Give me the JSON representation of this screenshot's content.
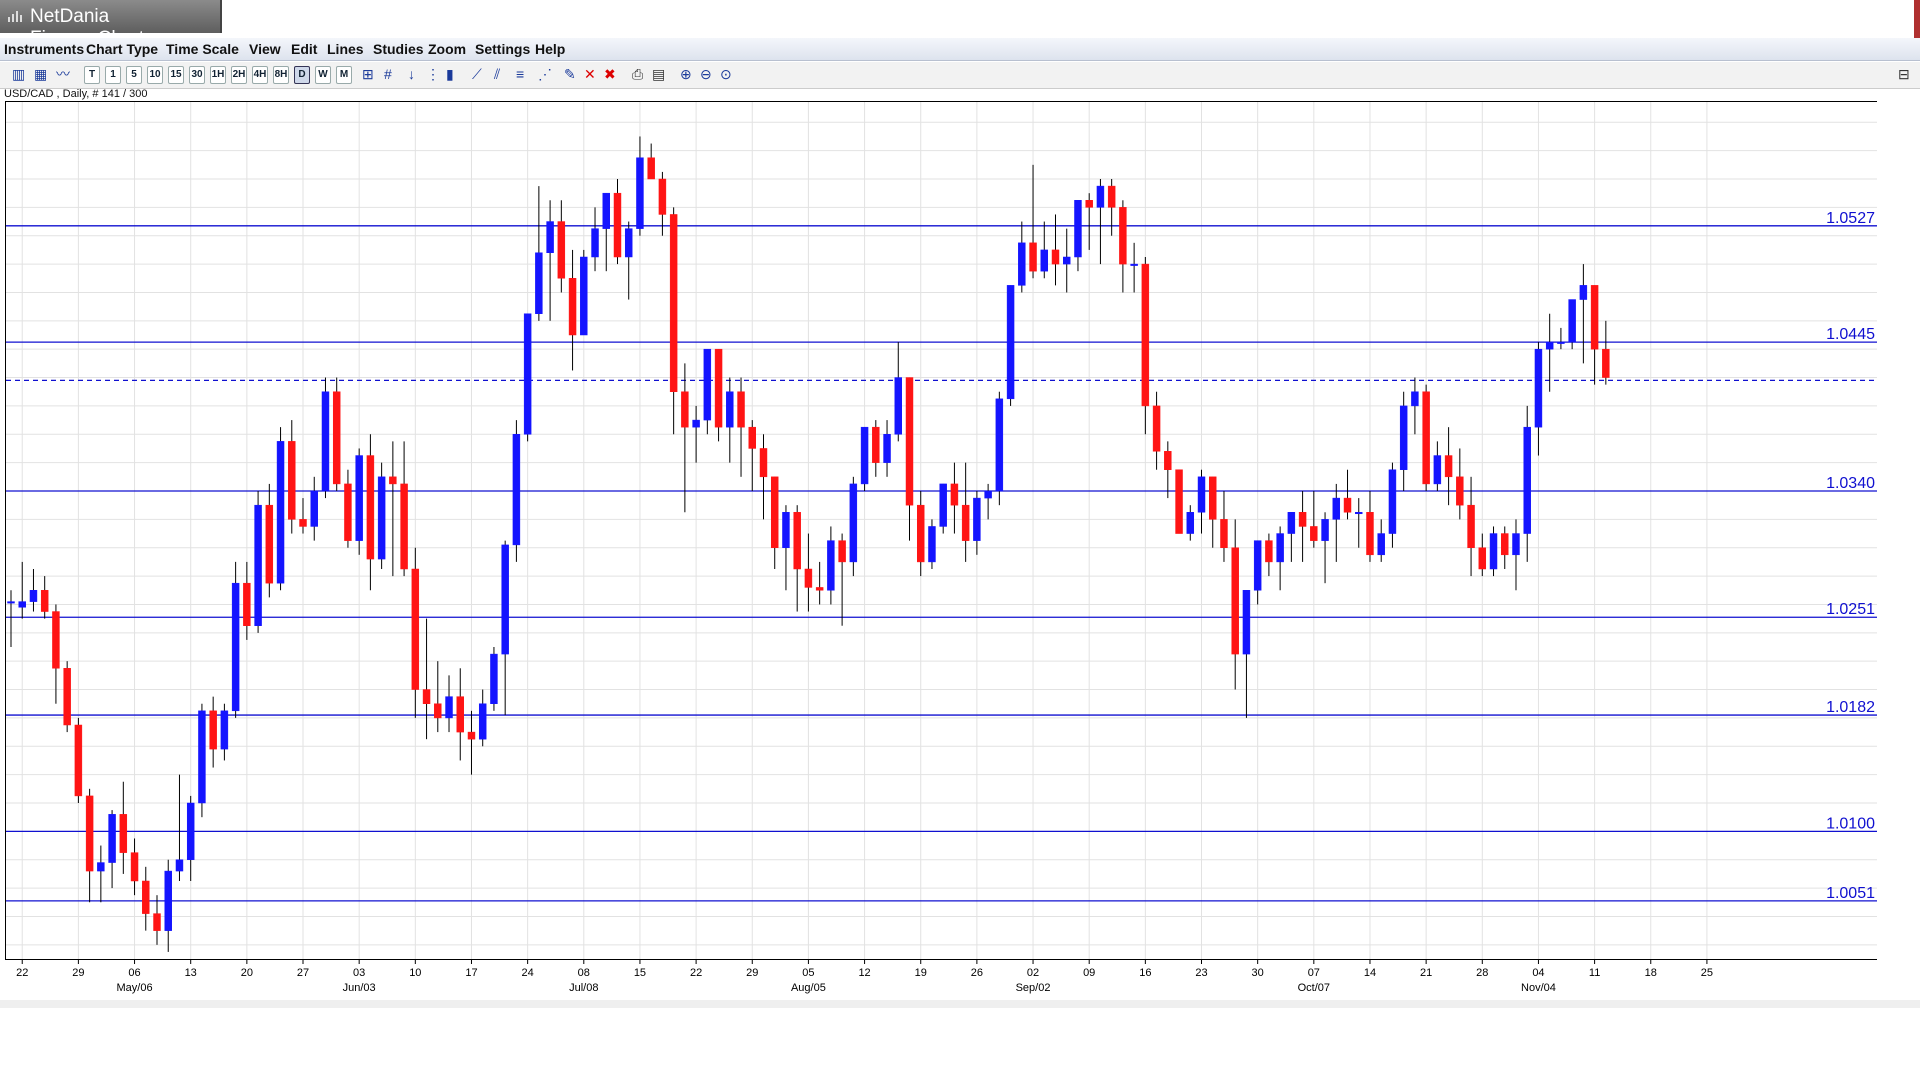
{
  "window": {
    "title": "NetDania FinanceChart"
  },
  "menu": [
    "Instruments",
    "Chart Type",
    "Time Scale",
    "View",
    "Edit",
    "Lines",
    "Studies",
    "Zoom",
    "Settings",
    "Help"
  ],
  "toolbar": {
    "timeframes": [
      "T",
      "1",
      "5",
      "10",
      "15",
      "30",
      "1H",
      "2H",
      "4H",
      "8H",
      "D",
      "W",
      "M"
    ],
    "selected": "D"
  },
  "status": {
    "text": "USD/CAD , Daily, # 141 / 300"
  },
  "chart_data": {
    "type": "candlestick",
    "instrument": "USD/CAD",
    "timeframe": "Daily",
    "ylim": [
      1.001,
      1.0615
    ],
    "y_ticks": [
      "1.0600",
      "1.0580",
      "1.0560",
      "1.0540",
      "1.0520",
      "1.0500",
      "1.0480",
      "1.0460",
      "1.0440",
      "1.0420",
      "1.0400",
      "1.0380",
      "1.0360",
      "1.0340",
      "1.0320",
      "1.0300",
      "1.0280",
      "1.0260",
      "1.0240",
      "1.0220",
      "1.0200",
      "1.0180",
      "1.0160",
      "1.0140",
      "1.0120",
      "1.0100",
      "1.0080",
      "1.0060",
      "1.0040",
      "1.0020"
    ],
    "x_ticks": [
      "22",
      "29",
      "06",
      "13",
      "20",
      "27",
      "03",
      "10",
      "17",
      "24",
      "08",
      "15",
      "22",
      "29",
      "05",
      "12",
      "19",
      "26",
      "02",
      "09",
      "16",
      "23",
      "30",
      "07",
      "14",
      "21",
      "28",
      "04",
      "11",
      "18",
      "25"
    ],
    "x_month_labels": [
      "May/06",
      "Jun/03",
      "Jul/08",
      "Aug/05",
      "Sep/02",
      "Oct/07",
      "Nov/04"
    ],
    "horizontal_lines": [
      "1.0527",
      "1.0445",
      "1.0340",
      "1.0251",
      "1.0182",
      "1.0100",
      "1.0051"
    ],
    "current_price": "1.0418",
    "grid": true,
    "candles": [
      [
        1.0262,
        1.027,
        1.023,
        1.0262
      ],
      [
        1.0258,
        1.029,
        1.025,
        1.0262
      ],
      [
        1.0262,
        1.0285,
        1.0255,
        1.027
      ],
      [
        1.027,
        1.028,
        1.025,
        1.0255
      ],
      [
        1.0255,
        1.026,
        1.019,
        1.0215
      ],
      [
        1.0215,
        1.022,
        1.017,
        1.0175
      ],
      [
        1.0175,
        1.018,
        1.012,
        1.0125
      ],
      [
        1.0125,
        1.013,
        1.005,
        1.0072
      ],
      [
        1.0072,
        1.009,
        1.005,
        1.0078
      ],
      [
        1.0078,
        1.0115,
        1.006,
        1.0112
      ],
      [
        1.0112,
        1.0135,
        1.007,
        1.0085
      ],
      [
        1.0085,
        1.0095,
        1.0055,
        1.0065
      ],
      [
        1.0065,
        1.0075,
        1.003,
        1.0042
      ],
      [
        1.0042,
        1.0055,
        1.002,
        1.003
      ],
      [
        1.003,
        1.008,
        1.0015,
        1.0072
      ],
      [
        1.0072,
        1.014,
        1.0065,
        1.008
      ],
      [
        1.008,
        1.0125,
        1.0065,
        1.012
      ],
      [
        1.012,
        1.019,
        1.011,
        1.0185
      ],
      [
        1.0185,
        1.0195,
        1.0145,
        1.0158
      ],
      [
        1.0158,
        1.019,
        1.015,
        1.0185
      ],
      [
        1.0185,
        1.029,
        1.018,
        1.0275
      ],
      [
        1.0275,
        1.029,
        1.0235,
        1.0245
      ],
      [
        1.0245,
        1.034,
        1.024,
        1.033
      ],
      [
        1.033,
        1.0345,
        1.0265,
        1.0275
      ],
      [
        1.0275,
        1.0385,
        1.027,
        1.0375
      ],
      [
        1.0375,
        1.039,
        1.031,
        1.032
      ],
      [
        1.032,
        1.0335,
        1.031,
        1.0315
      ],
      [
        1.0315,
        1.035,
        1.0305,
        1.034
      ],
      [
        1.034,
        1.042,
        1.0335,
        1.041
      ],
      [
        1.041,
        1.042,
        1.034,
        1.0345
      ],
      [
        1.0345,
        1.0355,
        1.03,
        1.0305
      ],
      [
        1.0305,
        1.037,
        1.0295,
        1.0365
      ],
      [
        1.0365,
        1.038,
        1.027,
        1.0292
      ],
      [
        1.0292,
        1.036,
        1.0285,
        1.035
      ],
      [
        1.035,
        1.0375,
        1.028,
        1.0345
      ],
      [
        1.0345,
        1.0375,
        1.028,
        1.0285
      ],
      [
        1.0285,
        1.03,
        1.018,
        1.02
      ],
      [
        1.02,
        1.025,
        1.0165,
        1.019
      ],
      [
        1.019,
        1.022,
        1.017,
        1.018
      ],
      [
        1.018,
        1.021,
        1.017,
        1.0195
      ],
      [
        1.0195,
        1.0215,
        1.015,
        1.017
      ],
      [
        1.017,
        1.0185,
        1.014,
        1.0165
      ],
      [
        1.0165,
        1.02,
        1.016,
        1.019
      ],
      [
        1.019,
        1.023,
        1.0185,
        1.0225
      ],
      [
        1.0225,
        1.0305,
        1.0182,
        1.0302
      ],
      [
        1.0302,
        1.039,
        1.029,
        1.038
      ],
      [
        1.038,
        1.0465,
        1.0375,
        1.0465
      ],
      [
        1.0465,
        1.0555,
        1.046,
        1.0508
      ],
      [
        1.0508,
        1.0545,
        1.046,
        1.053
      ],
      [
        1.053,
        1.0545,
        1.048,
        1.049
      ],
      [
        1.049,
        1.051,
        1.0425,
        1.045
      ],
      [
        1.045,
        1.051,
        1.045,
        1.0505
      ],
      [
        1.0505,
        1.054,
        1.0495,
        1.0525
      ],
      [
        1.0525,
        1.055,
        1.0495,
        1.055
      ],
      [
        1.055,
        1.056,
        1.05,
        1.0505
      ],
      [
        1.0505,
        1.053,
        1.0475,
        1.0525
      ],
      [
        1.0525,
        1.059,
        1.052,
        1.0575
      ],
      [
        1.0575,
        1.0585,
        1.056,
        1.056
      ],
      [
        1.056,
        1.0565,
        1.052,
        1.0535
      ],
      [
        1.0535,
        1.054,
        1.038,
        1.041
      ],
      [
        1.041,
        1.043,
        1.0325,
        1.0385
      ],
      [
        1.0385,
        1.04,
        1.036,
        1.039
      ],
      [
        1.039,
        1.044,
        1.038,
        1.044
      ],
      [
        1.044,
        1.044,
        1.0375,
        1.0385
      ],
      [
        1.0385,
        1.042,
        1.036,
        1.041
      ],
      [
        1.041,
        1.042,
        1.035,
        1.0385
      ],
      [
        1.0385,
        1.039,
        1.034,
        1.037
      ],
      [
        1.037,
        1.038,
        1.032,
        1.035
      ],
      [
        1.035,
        1.034,
        1.0285,
        1.03
      ],
      [
        1.03,
        1.033,
        1.027,
        1.0325
      ],
      [
        1.0325,
        1.033,
        1.0255,
        1.0285
      ],
      [
        1.0285,
        1.031,
        1.0255,
        1.0272
      ],
      [
        1.0272,
        1.029,
        1.026,
        1.027
      ],
      [
        1.027,
        1.0315,
        1.026,
        1.0305
      ],
      [
        1.0305,
        1.031,
        1.0245,
        1.029
      ],
      [
        1.029,
        1.035,
        1.028,
        1.0345
      ],
      [
        1.0345,
        1.0385,
        1.034,
        1.0385
      ],
      [
        1.0385,
        1.039,
        1.035,
        1.036
      ],
      [
        1.036,
        1.039,
        1.035,
        1.038
      ],
      [
        1.038,
        1.0445,
        1.0375,
        1.042
      ],
      [
        1.042,
        1.042,
        1.0305,
        1.033
      ],
      [
        1.033,
        1.034,
        1.028,
        1.029
      ],
      [
        1.029,
        1.032,
        1.0285,
        1.0315
      ],
      [
        1.0315,
        1.0345,
        1.031,
        1.0345
      ],
      [
        1.0345,
        1.036,
        1.031,
        1.033
      ],
      [
        1.033,
        1.036,
        1.029,
        1.0305
      ],
      [
        1.0305,
        1.034,
        1.0295,
        1.0335
      ],
      [
        1.0335,
        1.0345,
        1.032,
        1.034
      ],
      [
        1.034,
        1.041,
        1.033,
        1.0405
      ],
      [
        1.0405,
        1.0485,
        1.04,
        1.0485
      ],
      [
        1.0485,
        1.053,
        1.048,
        1.0515
      ],
      [
        1.0515,
        1.057,
        1.049,
        1.0495
      ],
      [
        1.0495,
        1.053,
        1.049,
        1.051
      ],
      [
        1.051,
        1.0535,
        1.0485,
        1.05
      ],
      [
        1.05,
        1.0525,
        1.048,
        1.0505
      ],
      [
        1.0505,
        1.054,
        1.0495,
        1.0545
      ],
      [
        1.0545,
        1.055,
        1.051,
        1.054
      ],
      [
        1.054,
        1.056,
        1.05,
        1.0555
      ],
      [
        1.0555,
        1.056,
        1.052,
        1.054
      ],
      [
        1.054,
        1.0545,
        1.048,
        1.05
      ],
      [
        1.05,
        1.0515,
        1.048,
        1.05
      ],
      [
        1.05,
        1.0505,
        1.038,
        1.04
      ],
      [
        1.04,
        1.041,
        1.0355,
        1.0368
      ],
      [
        1.0368,
        1.0375,
        1.0335,
        1.0355
      ],
      [
        1.0355,
        1.0355,
        1.031,
        1.031
      ],
      [
        1.031,
        1.033,
        1.0305,
        1.0325
      ],
      [
        1.0325,
        1.0355,
        1.031,
        1.035
      ],
      [
        1.035,
        1.033,
        1.03,
        1.032
      ],
      [
        1.032,
        1.034,
        1.029,
        1.03
      ],
      [
        1.03,
        1.032,
        1.02,
        1.0225
      ],
      [
        1.0225,
        1.027,
        1.018,
        1.027
      ],
      [
        1.027,
        1.03,
        1.026,
        1.0305
      ],
      [
        1.0305,
        1.031,
        1.028,
        1.029
      ],
      [
        1.029,
        1.0315,
        1.027,
        1.031
      ],
      [
        1.031,
        1.0325,
        1.029,
        1.0325
      ],
      [
        1.0325,
        1.034,
        1.029,
        1.0315
      ],
      [
        1.0315,
        1.034,
        1.03,
        1.0305
      ],
      [
        1.0305,
        1.0325,
        1.0275,
        1.032
      ],
      [
        1.032,
        1.0345,
        1.029,
        1.0335
      ],
      [
        1.0335,
        1.0355,
        1.032,
        1.0325
      ],
      [
        1.0325,
        1.0335,
        1.03,
        1.0325
      ],
      [
        1.0325,
        1.034,
        1.029,
        1.0295
      ],
      [
        1.0295,
        1.032,
        1.029,
        1.031
      ],
      [
        1.031,
        1.036,
        1.03,
        1.0355
      ],
      [
        1.0355,
        1.041,
        1.034,
        1.04
      ],
      [
        1.04,
        1.042,
        1.038,
        1.041
      ],
      [
        1.041,
        1.0415,
        1.034,
        1.0345
      ],
      [
        1.0345,
        1.0375,
        1.034,
        1.0365
      ],
      [
        1.0365,
        1.0385,
        1.033,
        1.035
      ],
      [
        1.035,
        1.037,
        1.032,
        1.033
      ],
      [
        1.033,
        1.035,
        1.028,
        1.03
      ],
      [
        1.03,
        1.031,
        1.028,
        1.0285
      ],
      [
        1.0285,
        1.0315,
        1.028,
        1.031
      ],
      [
        1.031,
        1.0315,
        1.0285,
        1.0295
      ],
      [
        1.0295,
        1.032,
        1.027,
        1.031
      ],
      [
        1.031,
        1.04,
        1.029,
        1.0385
      ],
      [
        1.0385,
        1.0445,
        1.0365,
        1.044
      ],
      [
        1.044,
        1.0465,
        1.041,
        1.0445
      ],
      [
        1.0445,
        1.0455,
        1.044,
        1.0445
      ],
      [
        1.0445,
        1.0475,
        1.044,
        1.0475
      ],
      [
        1.0475,
        1.05,
        1.043,
        1.0485
      ],
      [
        1.0485,
        1.0485,
        1.0415,
        1.044
      ],
      [
        1.044,
        1.046,
        1.0415,
        1.042
      ]
    ]
  }
}
